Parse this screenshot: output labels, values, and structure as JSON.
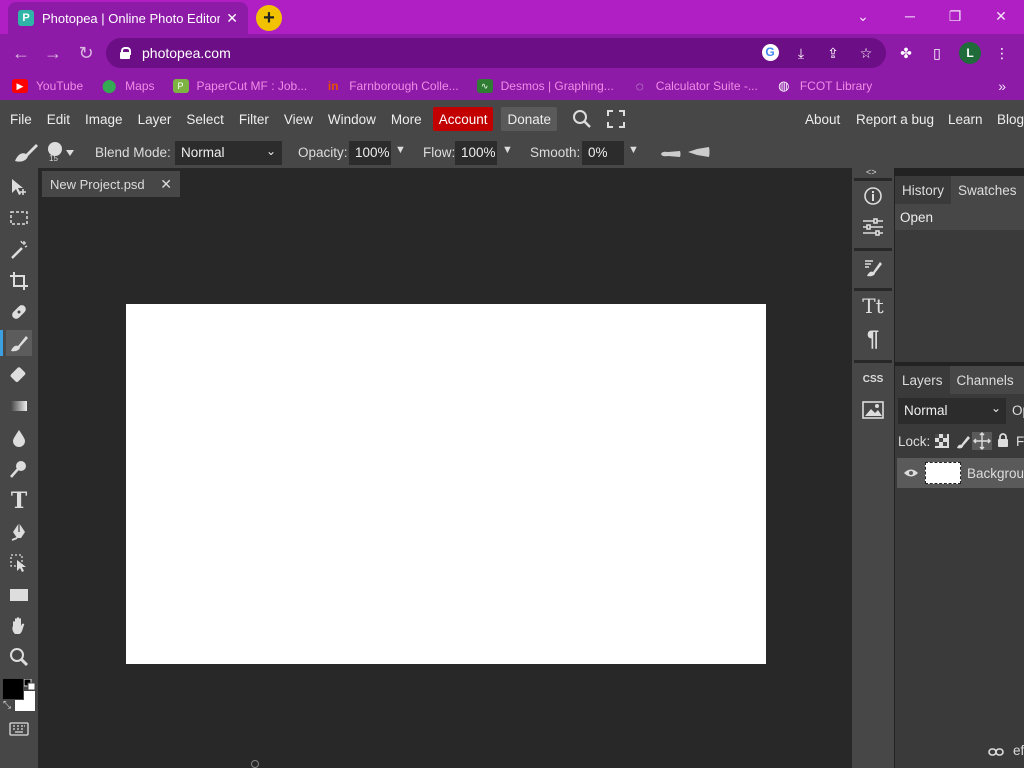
{
  "browser": {
    "tab_title": "Photopea | Online Photo Editor",
    "tab_icon": "photopea-favicon",
    "url": "photopea.com",
    "profile_initial": "L",
    "bookmarks": [
      {
        "label": "YouTube",
        "icon": "youtube-icon",
        "color": "#ff0000"
      },
      {
        "label": "Maps",
        "icon": "maps-pin-icon",
        "color": "#34a853"
      },
      {
        "label": "PaperCut MF : Job...",
        "icon": "papercut-icon",
        "color": "#7cb342"
      },
      {
        "label": "Farnborough Colle...",
        "icon": "fcot-icon",
        "color": "#e65100"
      },
      {
        "label": "Desmos | Graphing...",
        "icon": "desmos-icon",
        "color": "#2e7d32"
      },
      {
        "label": "Calculator Suite -...",
        "icon": "geogebra-icon",
        "color": "#666666"
      },
      {
        "label": "FCOT Library",
        "icon": "globe-icon",
        "color": "#ffffff"
      }
    ]
  },
  "menu": {
    "items": [
      "File",
      "Edit",
      "Image",
      "Layer",
      "Select",
      "Filter",
      "View",
      "Window",
      "More"
    ],
    "account": "Account",
    "donate": "Donate",
    "right": [
      "About",
      "Report a bug",
      "Learn",
      "Blog"
    ]
  },
  "options": {
    "brush_size": "15",
    "blend_mode_label": "Blend Mode:",
    "blend_mode": "Normal",
    "opacity_label": "Opacity:",
    "opacity": "100%",
    "flow_label": "Flow:",
    "flow": "100%",
    "smooth_label": "Smooth:",
    "smooth": "0%"
  },
  "document": {
    "tab_name": "New Project.psd"
  },
  "panels": {
    "history_tab": "History",
    "swatches_tab": "Swatches",
    "history_items": [
      "Open"
    ],
    "layers_tab": "Layers",
    "channels_tab": "Channels",
    "layer_blend": "Normal",
    "opacity_cut": "Op",
    "lock_label": "Lock:",
    "fill_cut": "F",
    "layers": [
      {
        "name": "Backgrou"
      }
    ],
    "footer_cut": "ef"
  },
  "colors": {
    "foreground": "#000000",
    "background": "#ffffff",
    "account_bg": "#c20000",
    "chrome_purple": "#8e1aa8"
  }
}
